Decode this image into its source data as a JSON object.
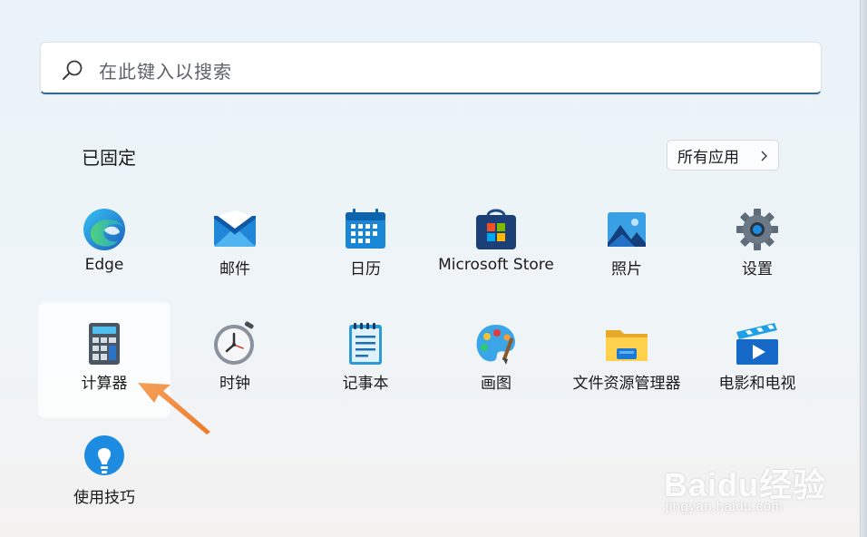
{
  "search": {
    "placeholder": "在此键入以搜索"
  },
  "pinned": {
    "title": "已固定",
    "all_apps_label": "所有应用"
  },
  "apps": [
    {
      "label": "Edge",
      "icon": "edge-icon"
    },
    {
      "label": "邮件",
      "icon": "mail-icon"
    },
    {
      "label": "日历",
      "icon": "calendar-icon"
    },
    {
      "label": "Microsoft Store",
      "icon": "store-icon"
    },
    {
      "label": "照片",
      "icon": "photos-icon"
    },
    {
      "label": "设置",
      "icon": "gear-icon"
    },
    {
      "label": "计算器",
      "icon": "calculator-icon",
      "selected": true
    },
    {
      "label": "时钟",
      "icon": "clock-icon"
    },
    {
      "label": "记事本",
      "icon": "notepad-icon"
    },
    {
      "label": "画图",
      "icon": "paint-icon"
    },
    {
      "label": "文件资源管理器",
      "icon": "folder-icon"
    },
    {
      "label": "电影和电视",
      "icon": "movies-icon"
    },
    {
      "label": "使用技巧",
      "icon": "tips-icon"
    }
  ],
  "watermark": {
    "logo": "Baidu经验",
    "sub": "jingyan.baidu.com"
  },
  "colors": {
    "search_underline": "#2b6a8c",
    "annotation_arrow": "#f08a3a"
  }
}
